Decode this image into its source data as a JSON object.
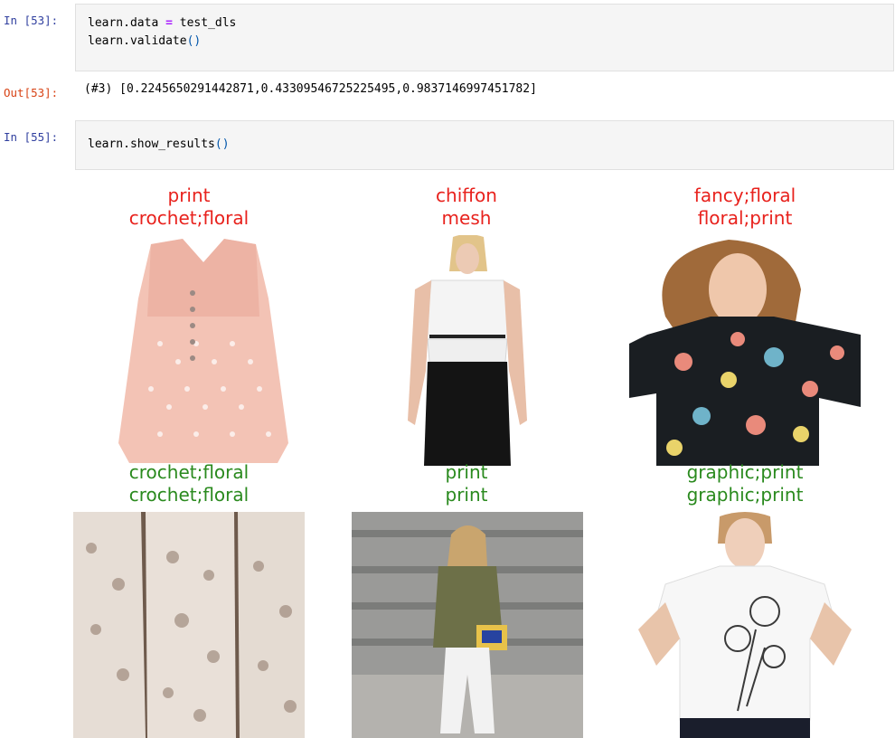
{
  "cells": [
    {
      "in_prompt": "In [53]:",
      "code": {
        "obj1": "learn",
        "attr1": "data",
        "op": "=",
        "rhs": "test_dls",
        "obj2": "learn",
        "call2": "validate",
        "parens2": "()"
      },
      "out_prompt": "Out[53]:",
      "output": "(#3) [0.2245650291442871,0.43309546725225495,0.9837146997451782]"
    },
    {
      "in_prompt": "In [55]:",
      "code": {
        "obj": "learn",
        "call": "show_results",
        "parens": "()"
      }
    }
  ],
  "results": [
    {
      "target": "print",
      "prediction": "crochet;floral",
      "correct": false,
      "image": "sleeveless-pink-dotted-blouse"
    },
    {
      "target": "chiffon",
      "prediction": "mesh",
      "correct": false,
      "image": "white-top-black-skirt-model"
    },
    {
      "target": "fancy;floral",
      "prediction": "floral;print",
      "correct": false,
      "image": "floral-print-tshirt-model"
    },
    {
      "target": "crochet;floral",
      "prediction": "crochet;floral",
      "correct": true,
      "image": "white-lace-dress-views"
    },
    {
      "target": "print",
      "prediction": "print",
      "correct": true,
      "image": "olive-jacket-white-jeans-street"
    },
    {
      "target": "graphic;print",
      "prediction": "graphic;print",
      "correct": true,
      "image": "white-graphic-tee-model"
    }
  ],
  "colors": {
    "wrong": "#e8221d",
    "right": "#2a8a1e",
    "prompt_in": "#303f9f",
    "prompt_out": "#d84315"
  }
}
